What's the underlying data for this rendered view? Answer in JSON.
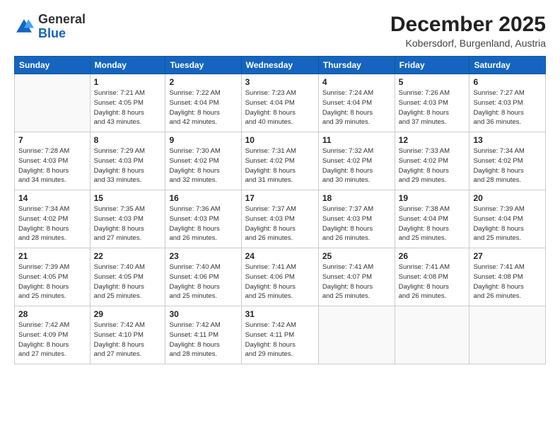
{
  "logo": {
    "general": "General",
    "blue": "Blue"
  },
  "header": {
    "month": "December 2025",
    "location": "Kobersdorf, Burgenland, Austria"
  },
  "weekdays": [
    "Sunday",
    "Monday",
    "Tuesday",
    "Wednesday",
    "Thursday",
    "Friday",
    "Saturday"
  ],
  "weeks": [
    [
      {
        "day": "",
        "info": ""
      },
      {
        "day": "1",
        "info": "Sunrise: 7:21 AM\nSunset: 4:05 PM\nDaylight: 8 hours\nand 43 minutes."
      },
      {
        "day": "2",
        "info": "Sunrise: 7:22 AM\nSunset: 4:04 PM\nDaylight: 8 hours\nand 42 minutes."
      },
      {
        "day": "3",
        "info": "Sunrise: 7:23 AM\nSunset: 4:04 PM\nDaylight: 8 hours\nand 40 minutes."
      },
      {
        "day": "4",
        "info": "Sunrise: 7:24 AM\nSunset: 4:04 PM\nDaylight: 8 hours\nand 39 minutes."
      },
      {
        "day": "5",
        "info": "Sunrise: 7:26 AM\nSunset: 4:03 PM\nDaylight: 8 hours\nand 37 minutes."
      },
      {
        "day": "6",
        "info": "Sunrise: 7:27 AM\nSunset: 4:03 PM\nDaylight: 8 hours\nand 36 minutes."
      }
    ],
    [
      {
        "day": "7",
        "info": "Sunrise: 7:28 AM\nSunset: 4:03 PM\nDaylight: 8 hours\nand 34 minutes."
      },
      {
        "day": "8",
        "info": "Sunrise: 7:29 AM\nSunset: 4:03 PM\nDaylight: 8 hours\nand 33 minutes."
      },
      {
        "day": "9",
        "info": "Sunrise: 7:30 AM\nSunset: 4:02 PM\nDaylight: 8 hours\nand 32 minutes."
      },
      {
        "day": "10",
        "info": "Sunrise: 7:31 AM\nSunset: 4:02 PM\nDaylight: 8 hours\nand 31 minutes."
      },
      {
        "day": "11",
        "info": "Sunrise: 7:32 AM\nSunset: 4:02 PM\nDaylight: 8 hours\nand 30 minutes."
      },
      {
        "day": "12",
        "info": "Sunrise: 7:33 AM\nSunset: 4:02 PM\nDaylight: 8 hours\nand 29 minutes."
      },
      {
        "day": "13",
        "info": "Sunrise: 7:34 AM\nSunset: 4:02 PM\nDaylight: 8 hours\nand 28 minutes."
      }
    ],
    [
      {
        "day": "14",
        "info": "Sunrise: 7:34 AM\nSunset: 4:02 PM\nDaylight: 8 hours\nand 28 minutes."
      },
      {
        "day": "15",
        "info": "Sunrise: 7:35 AM\nSunset: 4:03 PM\nDaylight: 8 hours\nand 27 minutes."
      },
      {
        "day": "16",
        "info": "Sunrise: 7:36 AM\nSunset: 4:03 PM\nDaylight: 8 hours\nand 26 minutes."
      },
      {
        "day": "17",
        "info": "Sunrise: 7:37 AM\nSunset: 4:03 PM\nDaylight: 8 hours\nand 26 minutes."
      },
      {
        "day": "18",
        "info": "Sunrise: 7:37 AM\nSunset: 4:03 PM\nDaylight: 8 hours\nand 26 minutes."
      },
      {
        "day": "19",
        "info": "Sunrise: 7:38 AM\nSunset: 4:04 PM\nDaylight: 8 hours\nand 25 minutes."
      },
      {
        "day": "20",
        "info": "Sunrise: 7:39 AM\nSunset: 4:04 PM\nDaylight: 8 hours\nand 25 minutes."
      }
    ],
    [
      {
        "day": "21",
        "info": "Sunrise: 7:39 AM\nSunset: 4:05 PM\nDaylight: 8 hours\nand 25 minutes."
      },
      {
        "day": "22",
        "info": "Sunrise: 7:40 AM\nSunset: 4:05 PM\nDaylight: 8 hours\nand 25 minutes."
      },
      {
        "day": "23",
        "info": "Sunrise: 7:40 AM\nSunset: 4:06 PM\nDaylight: 8 hours\nand 25 minutes."
      },
      {
        "day": "24",
        "info": "Sunrise: 7:41 AM\nSunset: 4:06 PM\nDaylight: 8 hours\nand 25 minutes."
      },
      {
        "day": "25",
        "info": "Sunrise: 7:41 AM\nSunset: 4:07 PM\nDaylight: 8 hours\nand 25 minutes."
      },
      {
        "day": "26",
        "info": "Sunrise: 7:41 AM\nSunset: 4:08 PM\nDaylight: 8 hours\nand 26 minutes."
      },
      {
        "day": "27",
        "info": "Sunrise: 7:41 AM\nSunset: 4:08 PM\nDaylight: 8 hours\nand 26 minutes."
      }
    ],
    [
      {
        "day": "28",
        "info": "Sunrise: 7:42 AM\nSunset: 4:09 PM\nDaylight: 8 hours\nand 27 minutes."
      },
      {
        "day": "29",
        "info": "Sunrise: 7:42 AM\nSunset: 4:10 PM\nDaylight: 8 hours\nand 27 minutes."
      },
      {
        "day": "30",
        "info": "Sunrise: 7:42 AM\nSunset: 4:11 PM\nDaylight: 8 hours\nand 28 minutes."
      },
      {
        "day": "31",
        "info": "Sunrise: 7:42 AM\nSunset: 4:11 PM\nDaylight: 8 hours\nand 29 minutes."
      },
      {
        "day": "",
        "info": ""
      },
      {
        "day": "",
        "info": ""
      },
      {
        "day": "",
        "info": ""
      }
    ]
  ]
}
